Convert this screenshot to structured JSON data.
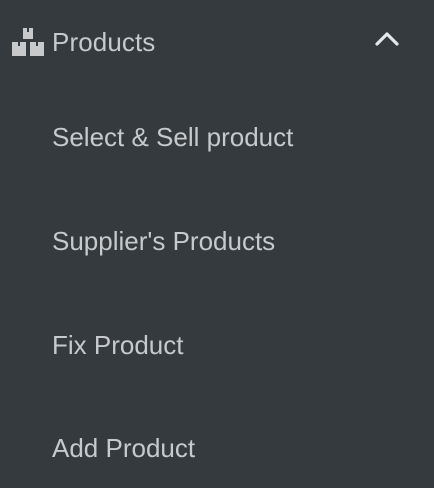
{
  "menu": {
    "section": {
      "title": "Products",
      "icon": "boxes-icon",
      "toggle_icon": "chevron-up-icon",
      "expanded": true
    },
    "items": [
      {
        "label": "Select & Sell product"
      },
      {
        "label": "Supplier's Products"
      },
      {
        "label": "Fix Product"
      },
      {
        "label": "Add Product"
      }
    ]
  },
  "colors": {
    "background": "#343a3e",
    "text": "#c7c9cb",
    "icon": "#c7c9cb"
  }
}
